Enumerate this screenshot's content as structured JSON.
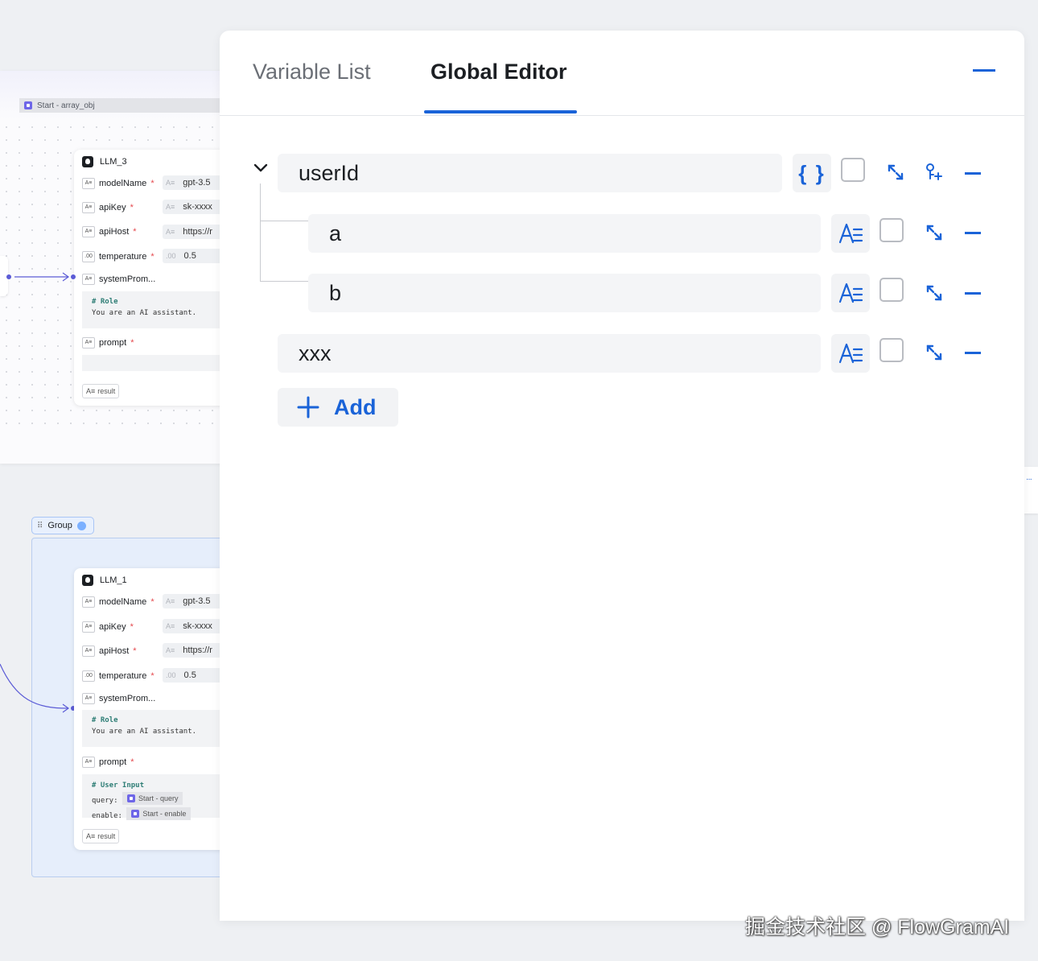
{
  "canvas": {
    "start_chip": "Start - array_obj",
    "llm3": {
      "title": "LLM_3",
      "fields": [
        {
          "type": "A≡",
          "label": "modelName",
          "required": "*",
          "value_type": "A≡",
          "value": "gpt-3.5"
        },
        {
          "type": "A≡",
          "label": "apiKey",
          "required": "*",
          "value_type": "A≡",
          "value": "sk-xxxx"
        },
        {
          "type": "A≡",
          "label": "apiHost",
          "required": "*",
          "value_type": "A≡",
          "value": "https://r"
        },
        {
          "type": ".00",
          "label": "temperature",
          "required": "*",
          "value_type": ".00",
          "value": "0.5"
        }
      ],
      "system_label": "systemProm...",
      "system_code_kw": "# Role",
      "system_code_line": "You are an AI assistant.",
      "prompt_label": "prompt",
      "prompt_required": "*",
      "result": "result"
    },
    "group_label": "Group",
    "llm1": {
      "title": "LLM_1",
      "fields": [
        {
          "type": "A≡",
          "label": "modelName",
          "required": "*",
          "value_type": "A≡",
          "value": "gpt-3.5"
        },
        {
          "type": "A≡",
          "label": "apiKey",
          "required": "*",
          "value_type": "A≡",
          "value": "sk-xxxx"
        },
        {
          "type": "A≡",
          "label": "apiHost",
          "required": "*",
          "value_type": "A≡",
          "value": "https://r"
        },
        {
          "type": ".00",
          "label": "temperature",
          "required": "*",
          "value_type": ".00",
          "value": "0.5"
        }
      ],
      "system_label": "systemProm...",
      "system_code_kw": "# Role",
      "system_code_line": "You are an AI assistant.",
      "prompt_label": "prompt",
      "prompt_required": "*",
      "prompt_code_kw": "# User Input",
      "prompt_query_label": "query:",
      "prompt_query_chip": "Start - query",
      "prompt_enable_label": "enable:",
      "prompt_enable_chip": "Start - enable",
      "result": "result"
    },
    "right_tab_glyph": "···"
  },
  "panel": {
    "tabs": [
      {
        "label": "Variable List",
        "active": false
      },
      {
        "label": "Global Editor",
        "active": true
      }
    ],
    "variables": [
      {
        "name": "userId",
        "type_icon": "object-braces-icon",
        "type_glyph": "{ }",
        "level": 0,
        "expanded": true
      },
      {
        "name": "a",
        "type_icon": "string-type-icon",
        "level": 1
      },
      {
        "name": "b",
        "type_icon": "string-type-icon",
        "level": 1
      },
      {
        "name": "xxx",
        "type_icon": "string-type-icon",
        "level": 0
      }
    ],
    "add_label": "Add"
  },
  "colors": {
    "accent": "#1a63d8",
    "field_bg": "#f4f5f7",
    "node_port": "#5b5bd6",
    "group_bg": "#e6eefb"
  },
  "watermark": "掘金技术社区 @ FlowGramAI"
}
